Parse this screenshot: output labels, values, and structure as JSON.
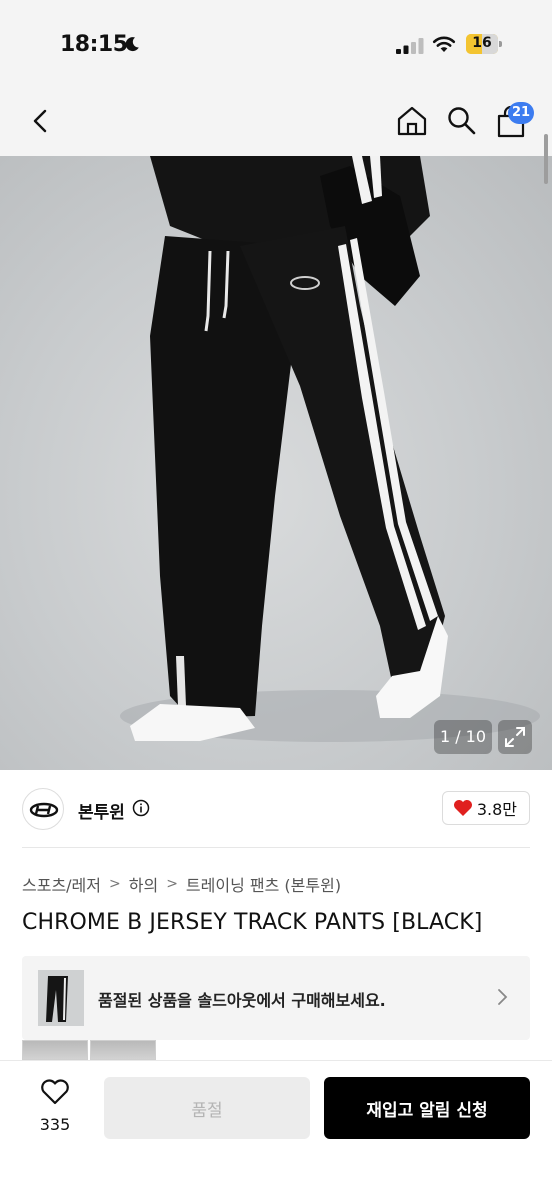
{
  "status_bar": {
    "time": "18:15",
    "battery": "16"
  },
  "nav": {
    "cart_count": "21"
  },
  "gallery": {
    "counter": "1 / 10"
  },
  "brand": {
    "name": "본투윈",
    "likes": "3.8만"
  },
  "breadcrumb": [
    "스포츠/레저",
    "하의",
    "트레이닝 팬츠 (본투윈)"
  ],
  "product": {
    "title": "CHROME B JERSEY TRACK PANTS [BLACK]"
  },
  "notice": {
    "text": "품절된 상품을 솔드아웃에서 구매해보세요."
  },
  "bottom": {
    "wish_count": "335",
    "soldout_label": "품절",
    "restock_label": "재입고 알림 신청"
  },
  "colors": {
    "accent_badge": "#3c7cf0",
    "heart": "#e0201f",
    "primary_button": "#000000"
  }
}
